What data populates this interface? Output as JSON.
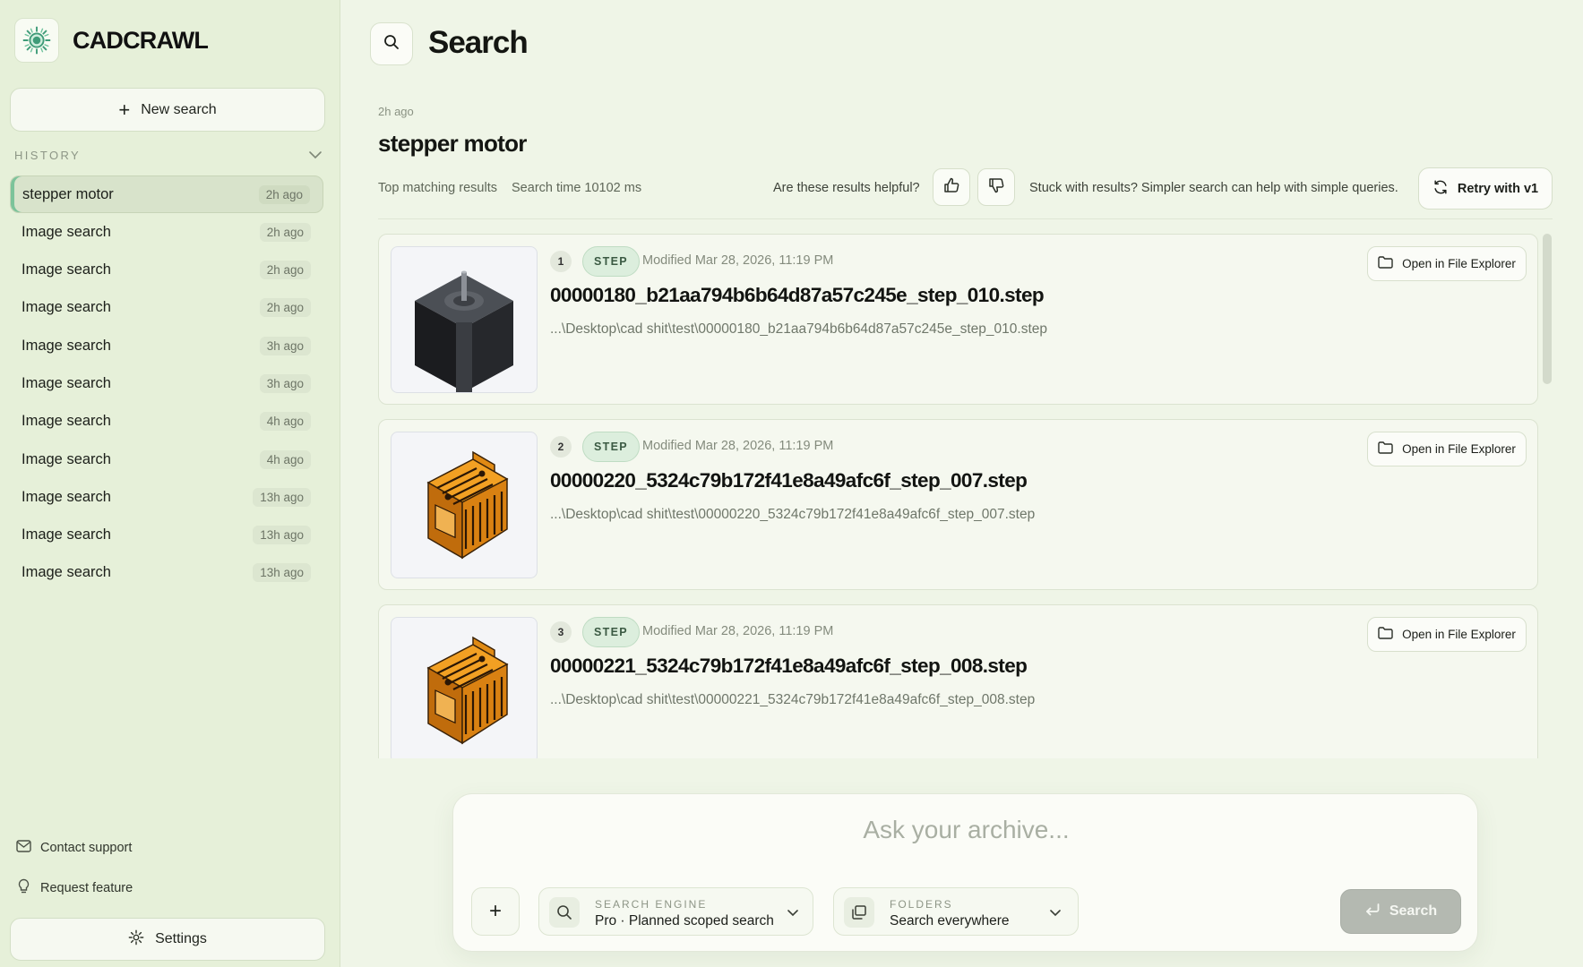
{
  "app": {
    "name": "CADCRAWL"
  },
  "sidebar": {
    "new_search_label": "New search",
    "history_label": "HISTORY",
    "items": [
      {
        "label": "stepper motor",
        "time": "2h ago",
        "active": true
      },
      {
        "label": "Image search",
        "time": "2h ago"
      },
      {
        "label": "Image search",
        "time": "2h ago"
      },
      {
        "label": "Image search",
        "time": "2h ago"
      },
      {
        "label": "Image search",
        "time": "3h ago"
      },
      {
        "label": "Image search",
        "time": "3h ago"
      },
      {
        "label": "Image search",
        "time": "4h ago"
      },
      {
        "label": "Image search",
        "time": "4h ago"
      },
      {
        "label": "Image search",
        "time": "13h ago"
      },
      {
        "label": "Image search",
        "time": "13h ago"
      },
      {
        "label": "Image search",
        "time": "13h ago"
      }
    ],
    "contact_support": "Contact support",
    "request_feature": "Request feature",
    "settings_label": "Settings"
  },
  "main": {
    "title": "Search",
    "query_time": "2h ago",
    "query": "stepper motor",
    "meta": {
      "top_matching": "Top matching results",
      "search_time": "Search time 10102 ms",
      "helpful_question": "Are these results helpful?",
      "stuck_text": "Stuck with results? Simpler search can help with simple queries.",
      "retry_label": "Retry with v1"
    },
    "results": [
      {
        "rank": "1",
        "type": "STEP",
        "modified": "Modified Mar 28, 2026, 11:19 PM",
        "filename": "00000180_b21aa794b6b64d87a57c245e_step_010.step",
        "path": "...\\Desktop\\cad shit\\test\\00000180_b21aa794b6b64d87a57c245e_step_010.step",
        "open_label": "Open in File Explorer"
      },
      {
        "rank": "2",
        "type": "STEP",
        "modified": "Modified Mar 28, 2026, 11:19 PM",
        "filename": "00000220_5324c79b172f41e8a49afc6f_step_007.step",
        "path": "...\\Desktop\\cad shit\\test\\00000220_5324c79b172f41e8a49afc6f_step_007.step",
        "open_label": "Open in File Explorer"
      },
      {
        "rank": "3",
        "type": "STEP",
        "modified": "Modified Mar 28, 2026, 11:19 PM",
        "filename": "00000221_5324c79b172f41e8a49afc6f_step_008.step",
        "path": "...\\Desktop\\cad shit\\test\\00000221_5324c79b172f41e8a49afc6f_step_008.step",
        "open_label": "Open in File Explorer"
      }
    ]
  },
  "composer": {
    "placeholder": "Ask your archive...",
    "engine_label": "SEARCH ENGINE",
    "engine_value": "Pro · Planned scoped search",
    "folders_label": "FOLDERS",
    "folders_value": "Search everywhere",
    "submit_label": "Search"
  },
  "colors": {
    "sidebar_bg": "#e6f0d9",
    "main_bg": "#eff5e7",
    "accent_green": "#7cc39a",
    "tag_bg": "#dceedd",
    "submit_disabled": "#b4b9b1"
  }
}
